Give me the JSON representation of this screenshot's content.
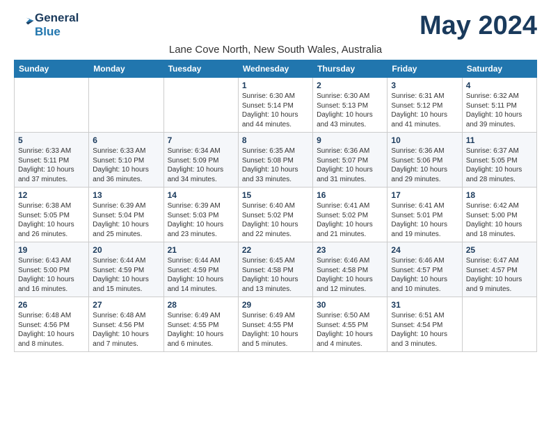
{
  "app": {
    "logo_line1": "General",
    "logo_line2": "Blue",
    "title": "May 2024",
    "location": "Lane Cove North, New South Wales, Australia"
  },
  "calendar": {
    "headers": [
      "Sunday",
      "Monday",
      "Tuesday",
      "Wednesday",
      "Thursday",
      "Friday",
      "Saturday"
    ],
    "rows": [
      [
        {
          "day": "",
          "info": ""
        },
        {
          "day": "",
          "info": ""
        },
        {
          "day": "",
          "info": ""
        },
        {
          "day": "1",
          "info": "Sunrise: 6:30 AM\nSunset: 5:14 PM\nDaylight: 10 hours\nand 44 minutes."
        },
        {
          "day": "2",
          "info": "Sunrise: 6:30 AM\nSunset: 5:13 PM\nDaylight: 10 hours\nand 43 minutes."
        },
        {
          "day": "3",
          "info": "Sunrise: 6:31 AM\nSunset: 5:12 PM\nDaylight: 10 hours\nand 41 minutes."
        },
        {
          "day": "4",
          "info": "Sunrise: 6:32 AM\nSunset: 5:11 PM\nDaylight: 10 hours\nand 39 minutes."
        }
      ],
      [
        {
          "day": "5",
          "info": "Sunrise: 6:33 AM\nSunset: 5:11 PM\nDaylight: 10 hours\nand 37 minutes."
        },
        {
          "day": "6",
          "info": "Sunrise: 6:33 AM\nSunset: 5:10 PM\nDaylight: 10 hours\nand 36 minutes."
        },
        {
          "day": "7",
          "info": "Sunrise: 6:34 AM\nSunset: 5:09 PM\nDaylight: 10 hours\nand 34 minutes."
        },
        {
          "day": "8",
          "info": "Sunrise: 6:35 AM\nSunset: 5:08 PM\nDaylight: 10 hours\nand 33 minutes."
        },
        {
          "day": "9",
          "info": "Sunrise: 6:36 AM\nSunset: 5:07 PM\nDaylight: 10 hours\nand 31 minutes."
        },
        {
          "day": "10",
          "info": "Sunrise: 6:36 AM\nSunset: 5:06 PM\nDaylight: 10 hours\nand 29 minutes."
        },
        {
          "day": "11",
          "info": "Sunrise: 6:37 AM\nSunset: 5:05 PM\nDaylight: 10 hours\nand 28 minutes."
        }
      ],
      [
        {
          "day": "12",
          "info": "Sunrise: 6:38 AM\nSunset: 5:05 PM\nDaylight: 10 hours\nand 26 minutes."
        },
        {
          "day": "13",
          "info": "Sunrise: 6:39 AM\nSunset: 5:04 PM\nDaylight: 10 hours\nand 25 minutes."
        },
        {
          "day": "14",
          "info": "Sunrise: 6:39 AM\nSunset: 5:03 PM\nDaylight: 10 hours\nand 23 minutes."
        },
        {
          "day": "15",
          "info": "Sunrise: 6:40 AM\nSunset: 5:02 PM\nDaylight: 10 hours\nand 22 minutes."
        },
        {
          "day": "16",
          "info": "Sunrise: 6:41 AM\nSunset: 5:02 PM\nDaylight: 10 hours\nand 21 minutes."
        },
        {
          "day": "17",
          "info": "Sunrise: 6:41 AM\nSunset: 5:01 PM\nDaylight: 10 hours\nand 19 minutes."
        },
        {
          "day": "18",
          "info": "Sunrise: 6:42 AM\nSunset: 5:00 PM\nDaylight: 10 hours\nand 18 minutes."
        }
      ],
      [
        {
          "day": "19",
          "info": "Sunrise: 6:43 AM\nSunset: 5:00 PM\nDaylight: 10 hours\nand 16 minutes."
        },
        {
          "day": "20",
          "info": "Sunrise: 6:44 AM\nSunset: 4:59 PM\nDaylight: 10 hours\nand 15 minutes."
        },
        {
          "day": "21",
          "info": "Sunrise: 6:44 AM\nSunset: 4:59 PM\nDaylight: 10 hours\nand 14 minutes."
        },
        {
          "day": "22",
          "info": "Sunrise: 6:45 AM\nSunset: 4:58 PM\nDaylight: 10 hours\nand 13 minutes."
        },
        {
          "day": "23",
          "info": "Sunrise: 6:46 AM\nSunset: 4:58 PM\nDaylight: 10 hours\nand 12 minutes."
        },
        {
          "day": "24",
          "info": "Sunrise: 6:46 AM\nSunset: 4:57 PM\nDaylight: 10 hours\nand 10 minutes."
        },
        {
          "day": "25",
          "info": "Sunrise: 6:47 AM\nSunset: 4:57 PM\nDaylight: 10 hours\nand 9 minutes."
        }
      ],
      [
        {
          "day": "26",
          "info": "Sunrise: 6:48 AM\nSunset: 4:56 PM\nDaylight: 10 hours\nand 8 minutes."
        },
        {
          "day": "27",
          "info": "Sunrise: 6:48 AM\nSunset: 4:56 PM\nDaylight: 10 hours\nand 7 minutes."
        },
        {
          "day": "28",
          "info": "Sunrise: 6:49 AM\nSunset: 4:55 PM\nDaylight: 10 hours\nand 6 minutes."
        },
        {
          "day": "29",
          "info": "Sunrise: 6:49 AM\nSunset: 4:55 PM\nDaylight: 10 hours\nand 5 minutes."
        },
        {
          "day": "30",
          "info": "Sunrise: 6:50 AM\nSunset: 4:55 PM\nDaylight: 10 hours\nand 4 minutes."
        },
        {
          "day": "31",
          "info": "Sunrise: 6:51 AM\nSunset: 4:54 PM\nDaylight: 10 hours\nand 3 minutes."
        },
        {
          "day": "",
          "info": ""
        }
      ]
    ]
  }
}
